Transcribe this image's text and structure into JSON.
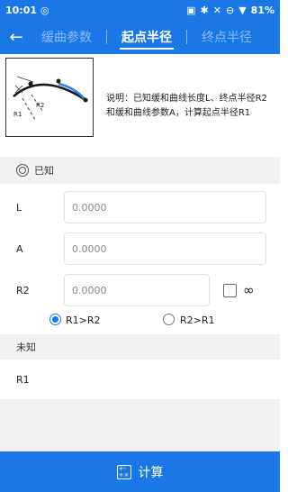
{
  "status_bar": {
    "time": "10:01",
    "battery": "81%"
  },
  "nav": {
    "tabs": [
      {
        "label": "缓曲参数",
        "active": false
      },
      {
        "label": "起点半径",
        "active": true
      },
      {
        "label": "终点半径",
        "active": false
      }
    ]
  },
  "diagram": {
    "label_r1": "R1",
    "label_r2": "R2"
  },
  "description": "说明：已知缓和曲线长度L、终点半径R2和缓和曲线参数A，计算起点半径R1",
  "known": {
    "title": "已知",
    "fields": [
      {
        "label": "L",
        "placeholder": "0.0000"
      },
      {
        "label": "A",
        "placeholder": "0.0000"
      },
      {
        "label": "R2",
        "placeholder": "0.0000"
      }
    ],
    "infinity_symbol": "∞"
  },
  "radio": {
    "options": [
      {
        "label": "R1>R2",
        "selected": true
      },
      {
        "label": "R2>R1",
        "selected": false
      }
    ]
  },
  "unknown": {
    "title": "未知",
    "result_label": "R1"
  },
  "calculate_button": {
    "label": "计算"
  },
  "colors": {
    "primary": "#1a77e6",
    "section_bg": "#f2f2f2"
  }
}
